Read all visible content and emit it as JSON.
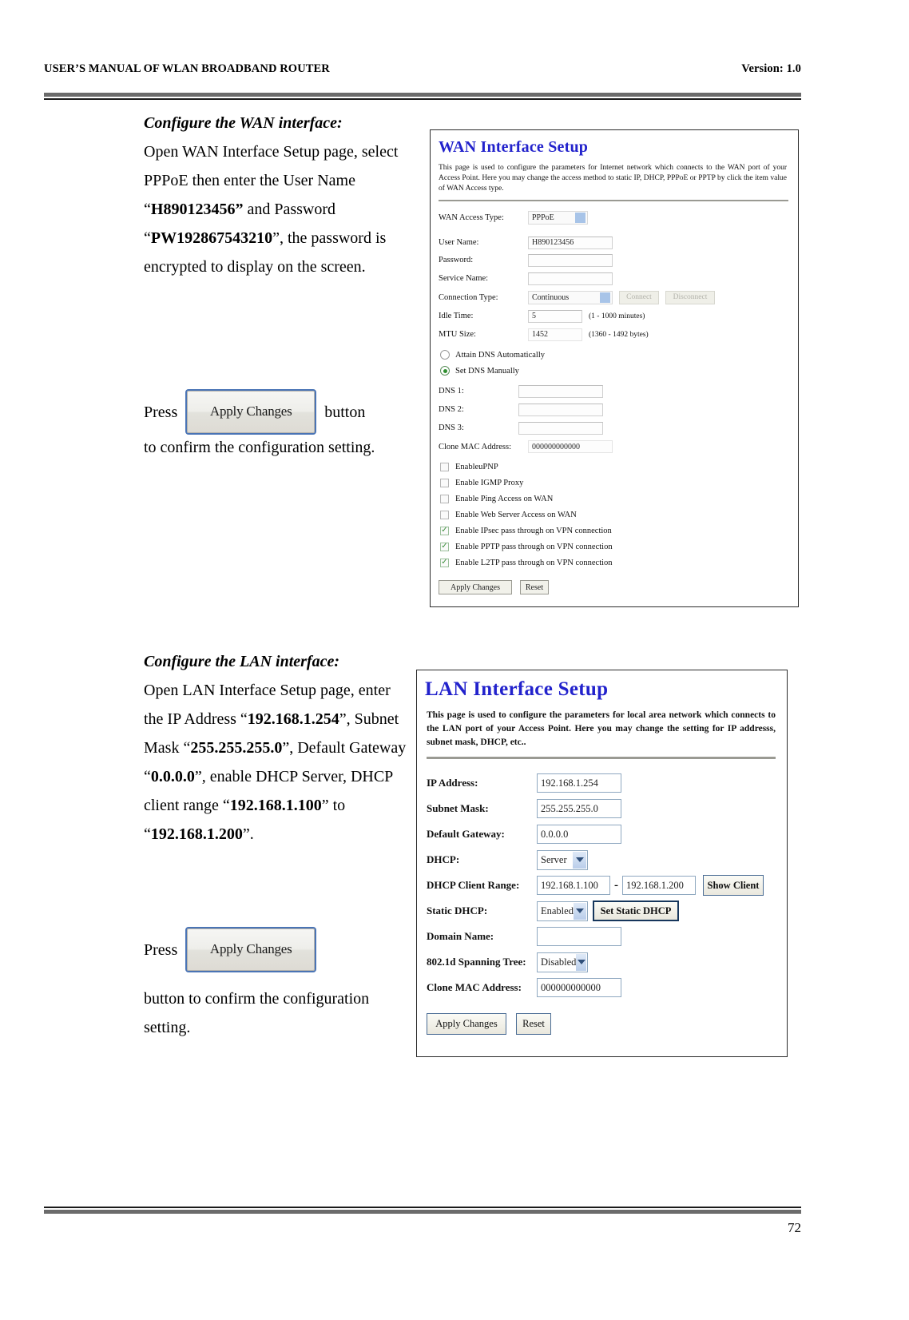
{
  "header": {
    "left": "USER’S MANUAL OF WLAN BROADBAND ROUTER",
    "right": "Version: 1.0"
  },
  "footer": {
    "page_number": "72"
  },
  "wan_section": {
    "heading": "Configure the WAN interface:",
    "body_1": "Open WAN Interface Setup page, select PPPoE then enter the User Name “",
    "bold_username": "H890123456”",
    "body_2": " and Password “",
    "bold_password": "PW192867543210",
    "body_3": "”, the password is encrypted to display on the screen.",
    "press_label": "Press",
    "apply_button": "Apply Changes",
    "press_tail": "button to confirm the configuration setting."
  },
  "lan_section": {
    "heading": "Configure the LAN interface:",
    "body_1": "Open LAN Interface Setup page, enter the IP Address “",
    "bold_ip": "192.168.1.254",
    "body_2": "”, Subnet Mask “",
    "bold_mask": "255.255.255.0",
    "body_3": "”, Default Gateway “",
    "bold_gw": "0.0.0.0",
    "body_4": "”, enable DHCP Server, DHCP client range “",
    "bold_range_start": "192.168.1.100",
    "body_5": "” to “",
    "bold_range_end": "192.168.1.200",
    "body_6": "”.",
    "press_label": "Press",
    "apply_button": "Apply Changes",
    "press_tail": "button to confirm the configuration setting."
  },
  "wan_shot": {
    "title": "WAN Interface Setup",
    "description": "This page is used to configure the parameters for Internet network which connects to the WAN port of your Access Point. Here you may change the access method to static IP, DHCP, PPPoE or PPTP by click the item value of WAN Access type.",
    "fields": {
      "access_type_label": "WAN Access Type:",
      "access_type_value": "PPPoE",
      "user_name_label": "User Name:",
      "user_name_value": "H890123456",
      "password_label": "Password:",
      "password_value": "",
      "service_name_label": "Service Name:",
      "service_name_value": "",
      "connection_type_label": "Connection Type:",
      "connection_type_value": "Continuous",
      "connect_button": "Connect",
      "disconnect_button": "Disconnect",
      "idle_time_label": "Idle Time:",
      "idle_time_value": "5",
      "idle_time_hint": "(1 - 1000 minutes)",
      "mtu_label": "MTU Size:",
      "mtu_value": "1452",
      "mtu_hint": "(1360 - 1492 bytes)",
      "dns_auto_label": "Attain DNS Automatically",
      "dns_manual_label": "Set DNS Manually",
      "dns1_label": "DNS 1:",
      "dns1_value": "",
      "dns2_label": "DNS 2:",
      "dns2_value": "",
      "dns3_label": "DNS 3:",
      "dns3_value": "",
      "clone_mac_label": "Clone MAC Address:",
      "clone_mac_value": "000000000000"
    },
    "checkboxes": [
      {
        "label": "EnableuPNP",
        "checked": false
      },
      {
        "label": "Enable IGMP Proxy",
        "checked": false
      },
      {
        "label": "Enable Ping Access on WAN",
        "checked": false
      },
      {
        "label": "Enable Web Server Access on WAN",
        "checked": false
      },
      {
        "label": "Enable IPsec pass through on VPN connection",
        "checked": true
      },
      {
        "label": "Enable PPTP pass through on VPN connection",
        "checked": true
      },
      {
        "label": "Enable L2TP pass through on VPN connection",
        "checked": true
      }
    ],
    "apply_button": "Apply Changes",
    "reset_button": "Reset"
  },
  "lan_shot": {
    "title": "LAN Interface Setup",
    "description": "This page is used to configure the parameters for local area network which connects to the LAN port of your Access Point. Here you may change the setting for IP addresss, subnet mask, DHCP, etc..",
    "fields": {
      "ip_label": "IP Address:",
      "ip_value": "192.168.1.254",
      "mask_label": "Subnet Mask:",
      "mask_value": "255.255.255.0",
      "gateway_label": "Default Gateway:",
      "gateway_value": "0.0.0.0",
      "dhcp_label": "DHCP:",
      "dhcp_value": "Server",
      "range_label": "DHCP Client Range:",
      "range_start": "192.168.1.100",
      "range_separator": "-",
      "range_end": "192.168.1.200",
      "show_client_button": "Show Client",
      "static_dhcp_label": "Static DHCP:",
      "static_dhcp_value": "Enabled",
      "set_static_dhcp_button": "Set Static DHCP",
      "domain_label": "Domain Name:",
      "domain_value": "",
      "stp_label": "802.1d Spanning Tree:",
      "stp_value": "Disabled",
      "clone_mac_label": "Clone MAC Address:",
      "clone_mac_value": "000000000000"
    },
    "apply_button": "Apply Changes",
    "reset_button": "Reset"
  },
  "colors": {
    "shot_title_blue": "#2222cc",
    "rule_grey": "#6b6b6b",
    "checkbox_green": "#3a8f3a",
    "lan_button_border": "#16365c"
  }
}
